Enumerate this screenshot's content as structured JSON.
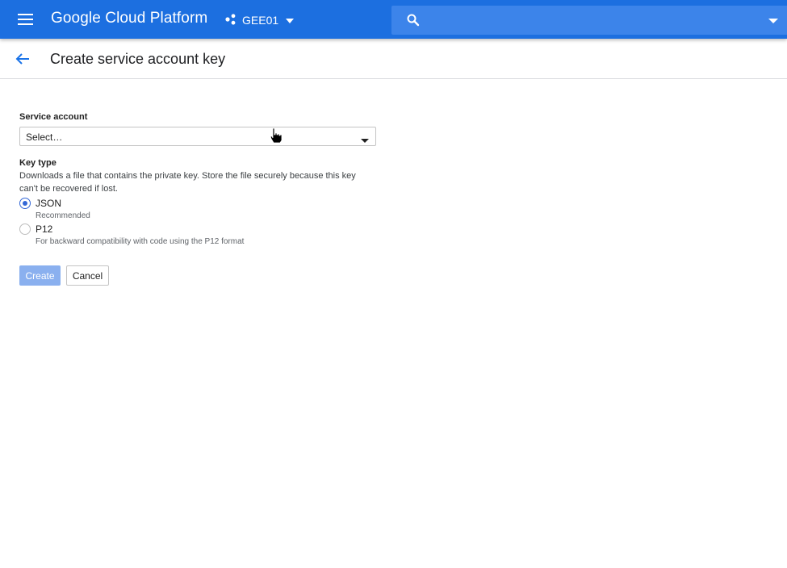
{
  "colors": {
    "appbar": "#1c6fe0",
    "search_bg": "#3c84ea",
    "primary": "#3367d6",
    "create_disabled": "#8ab0ef"
  },
  "appbar": {
    "menu_icon": "hamburger-menu-icon",
    "brand": "Google Cloud Platform",
    "project": {
      "icon": "project-nodes-icon",
      "name": "GEE01",
      "dropdown_icon": "caret-down-icon"
    },
    "search": {
      "icon": "search-icon",
      "placeholder": "",
      "value": "",
      "dropdown_icon": "caret-down-icon"
    }
  },
  "subheader": {
    "back_icon": "arrow-back-icon",
    "title": "Create service account key"
  },
  "form": {
    "service_account": {
      "label": "Service account",
      "selected": "Select…"
    },
    "key_type": {
      "label": "Key type",
      "description": "Downloads a file that contains the private key. Store the file securely because this key can't be recovered if lost.",
      "options": [
        {
          "label": "JSON",
          "help": "Recommended",
          "checked": true
        },
        {
          "label": "P12",
          "help": "For backward compatibility with code using the P12 format",
          "checked": false
        }
      ]
    },
    "buttons": {
      "create": "Create",
      "cancel": "Cancel"
    }
  }
}
